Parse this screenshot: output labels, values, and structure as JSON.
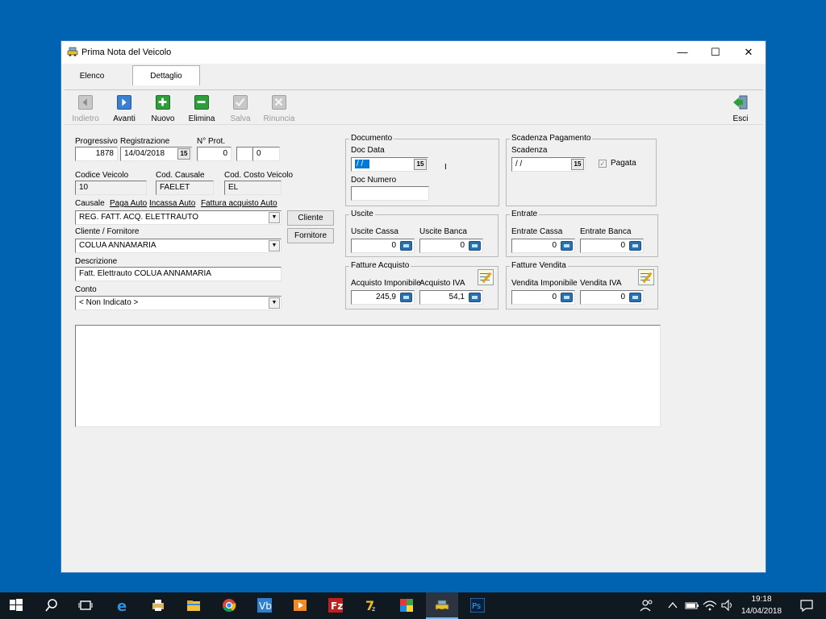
{
  "window": {
    "title": "Prima Nota del Veicolo",
    "controls": {
      "minimize": "—",
      "maximize": "☐",
      "close": "✕"
    }
  },
  "tabs": [
    {
      "label": "Elenco"
    },
    {
      "label": "Dettaglio"
    }
  ],
  "toolbar": {
    "indietro": "Indietro",
    "avanti": "Avanti",
    "nuovo": "Nuovo",
    "elimina": "Elimina",
    "salva": "Salva",
    "rinuncia": "Rinuncia",
    "esci": "Esci"
  },
  "form": {
    "progressivo": {
      "label": "Progressivo",
      "value": "1878"
    },
    "registrazione": {
      "label": "Registrazione",
      "value": "14/04/2018"
    },
    "nprot": {
      "label": "N° Prot.",
      "value1": "0",
      "value2": "",
      "value3": "0"
    },
    "codice_veicolo": {
      "label": "Codice Veicolo",
      "value": "10"
    },
    "cod_causale": {
      "label": "Cod. Causale",
      "value": "FAELET"
    },
    "cod_costo_veicolo": {
      "label": "Cod. Costo Veicolo",
      "value": "EL"
    },
    "causale": {
      "label": "Causale",
      "links": [
        "Paga Auto",
        "Incassa Auto",
        "Fattura acquisto Auto"
      ],
      "value": "REG. FATT. ACQ. ELETTRAUTO"
    },
    "cliente_fornitore": {
      "label": "Cliente / Fornitore",
      "value": "COLUA ANNAMARIA"
    },
    "descrizione": {
      "label": "Descrizione",
      "value": "Fatt. Elettrauto COLUA ANNAMARIA"
    },
    "conto": {
      "label": "Conto",
      "value": "< Non Indicato >"
    },
    "buttons": {
      "cliente": "Cliente",
      "fornitore": "Fornitore"
    }
  },
  "documento": {
    "title": "Documento",
    "doc_data_label": "Doc Data",
    "doc_data_value": "/ /",
    "doc_numero_label": "Doc Numero",
    "doc_numero_value": ""
  },
  "scadenza": {
    "title": "Scadenza Pagamento",
    "scadenza_label": "Scadenza",
    "scadenza_value": "/ /",
    "pagata_label": "Pagata",
    "pagata_checked": true
  },
  "uscite": {
    "title": "Uscite",
    "cassa_label": "Uscite Cassa",
    "cassa_value": "0",
    "banca_label": "Uscite Banca",
    "banca_value": "0"
  },
  "entrate": {
    "title": "Entrate",
    "cassa_label": "Entrate Cassa",
    "cassa_value": "0",
    "banca_label": "Entrate Banca",
    "banca_value": "0"
  },
  "fatture_acquisto": {
    "title": "Fatture Acquisto",
    "imponibile_label": "Acquisto Imponibile",
    "imponibile_value": "245,9",
    "iva_label": "Acquisto IVA",
    "iva_value": "54,1"
  },
  "fatture_vendita": {
    "title": "Fatture Vendita",
    "imponibile_label": "Vendita Imponibile",
    "imponibile_value": "0",
    "iva_label": "Vendita IVA",
    "iva_value": "0"
  },
  "glyphs": {
    "calendar": "15",
    "combo": "▼",
    "check": "✓"
  },
  "cursor_text": "I",
  "taskbar": {
    "clock_time": "19:18",
    "clock_date": "14/04/2018",
    "colors": {
      "background": "#101820",
      "accent": "#76b9ed"
    }
  }
}
